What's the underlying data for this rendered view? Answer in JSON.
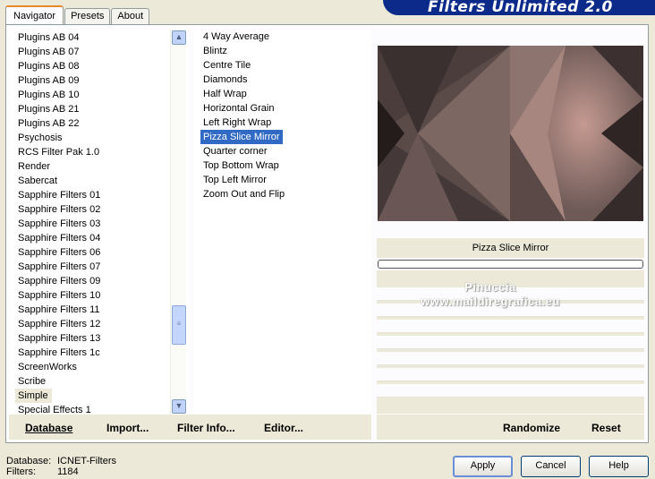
{
  "tabs": [
    "Navigator",
    "Presets",
    "About"
  ],
  "banner": "Filters Unlimited 2.0",
  "categories": [
    "Plugins AB 04",
    "Plugins AB 07",
    "Plugins AB 08",
    "Plugins AB 09",
    "Plugins AB 10",
    "Plugins AB 21",
    "Plugins AB 22",
    "Psychosis",
    "RCS Filter Pak 1.0",
    "Render",
    "Sabercat",
    "Sapphire Filters 01",
    "Sapphire Filters 02",
    "Sapphire Filters 03",
    "Sapphire Filters 04",
    "Sapphire Filters 06",
    "Sapphire Filters 07",
    "Sapphire Filters 09",
    "Sapphire Filters 10",
    "Sapphire Filters 11",
    "Sapphire Filters 12",
    "Sapphire Filters 13",
    "Sapphire Filters 1c",
    "ScreenWorks",
    "Scribe",
    "Simple",
    "Special Effects 1"
  ],
  "selected_category": "Simple",
  "filters": [
    "4 Way Average",
    "Blintz",
    "Centre Tile",
    "Diamonds",
    "Half Wrap",
    "Horizontal Grain",
    "Left Right Wrap",
    "Pizza Slice Mirror",
    "Quarter corner",
    "Top Bottom Wrap",
    "Top Left Mirror",
    "Zoom Out and Flip"
  ],
  "selected_filter": "Pizza Slice Mirror",
  "preview_label": "Pizza Slice Mirror",
  "watermark": [
    "Pinuccia",
    "www.maildiregrafica.eu"
  ],
  "buttons": {
    "database": "Database",
    "import": "Import...",
    "filter_info": "Filter Info...",
    "editor": "Editor...",
    "randomize": "Randomize",
    "reset": "Reset",
    "apply": "Apply",
    "cancel": "Cancel",
    "help": "Help"
  },
  "status": {
    "database_label": "Database:",
    "database_value": "ICNET-Filters",
    "filters_label": "Filters:",
    "filters_value": "1184"
  },
  "scrollbar": {
    "position": 0.72
  },
  "colors": {
    "selection": "#316ac5",
    "banner": "#0b2a8a",
    "tab_accent": "#e68b2c"
  },
  "icons": [
    "scroll-up-icon",
    "scroll-down-icon",
    "scroll-grip-icon"
  ]
}
